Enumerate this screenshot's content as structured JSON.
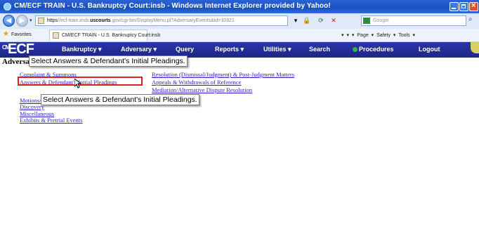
{
  "window": {
    "title": "CM/ECF TRAIN - U.S. Bankruptcy Court:insb - Windows Internet Explorer provided by Yahoo!"
  },
  "address_bar": {
    "url_prefix": "https",
    "url_host_hint": "//ecf-train.insb.",
    "url_site": "uscourts",
    "url_rest": ".gov/cgi-bin/DisplayMenu.pl?AdversaryEvents&id=10321",
    "search_placeholder": "Google"
  },
  "favorites_bar": {
    "favorites_label": "Favorites",
    "tab_label": "CM/ECF TRAIN - U.S. Bankruptcy Court:insb",
    "tools_text": "▾ ▾ ▾ Page ▾ Safety ▾ Tools ▾"
  },
  "ecf_menu": {
    "logo": "ECF",
    "logo_prefix": "CM",
    "items": [
      {
        "label": "Bankruptcy ▾",
        "underline_letter": "n"
      },
      {
        "label": "Adversary ▾"
      },
      {
        "label": "Query"
      },
      {
        "label": "Reports ▾"
      },
      {
        "label": "Utilities ▾"
      },
      {
        "label": "Search"
      },
      {
        "label": "Procedures"
      },
      {
        "label": "Logout"
      }
    ]
  },
  "page": {
    "heading": "Adversary Events",
    "left_links": [
      "Complaint & Summons",
      "Answers & Defendant's Initial Pleadings",
      "Motions/Applications",
      "Discovery",
      "Miscellaneous",
      "Exhibits & Pretrial Events"
    ],
    "right_links": [
      "Resolution (Dismissal/Judgment) & Post-Judgment Matters",
      "Appeals & Withdrawals of Reference",
      "Mediation/Alternative Dispute Resolution"
    ]
  },
  "callouts": {
    "top": "Select Answers & Defendant's Initial Pleadings.",
    "bottom": "Select Answers & Defendant's Initial Pleadings."
  },
  "colors": {
    "ecf_bar": "#1c2588",
    "link": "#2a1fc4",
    "highlight": "#e0201c"
  }
}
